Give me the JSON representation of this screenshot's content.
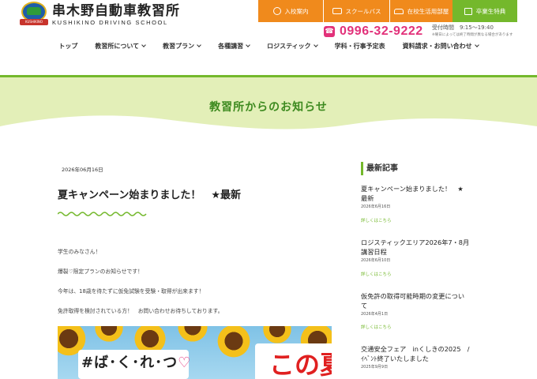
{
  "brand": {
    "name_jp": "串木野自動車教習所",
    "name_en": "KUSHIKINO DRIVING SCHOOL",
    "emblem_ribbon": "KUSHIKINO DRIVING"
  },
  "top_nav": [
    {
      "label": "入校案内",
      "icon": "steering-wheel-icon"
    },
    {
      "label": "スクールバス",
      "icon": "bus-icon"
    },
    {
      "label": "在校生活用部屋",
      "icon": "car-icon"
    },
    {
      "label": "卒業生特典",
      "icon": "gift-icon"
    }
  ],
  "contact": {
    "phone_icon_glyph": "☎",
    "phone": "0996-32-9222",
    "hours_label": "受付時間",
    "hours_value": "9:15～19:40",
    "hours_note": "※曜日によっては終了時間が異なる場合があります"
  },
  "main_nav": [
    {
      "label": "トップ",
      "has_dropdown": false
    },
    {
      "label": "教習所について",
      "has_dropdown": true
    },
    {
      "label": "教習プラン",
      "has_dropdown": true
    },
    {
      "label": "各種講習",
      "has_dropdown": true
    },
    {
      "label": "ロジスティック",
      "has_dropdown": true
    },
    {
      "label": "学科・行事予定表",
      "has_dropdown": false
    },
    {
      "label": "資料請求・お問い合わせ",
      "has_dropdown": true
    }
  ],
  "hero": {
    "title": "教習所からのお知らせ"
  },
  "article": {
    "date": "2026年06月16日",
    "title": "夏キャンペーン始まりました！　★最新",
    "paragraphs": [
      "学生のみなさん！",
      "爆裂♡限定プランのお知らせです！",
      "今年は、18歳を待たずに仮免試験を受験・取得が出来ます！",
      "免許取得を検討されている方！　お問い合わせお待ちしております。"
    ],
    "image": {
      "hashtag": "#ば･く･れ･つ",
      "heart": "♡",
      "headline": "この夏、"
    }
  },
  "sidebar": {
    "heading": "最新記事",
    "more_label": "詳しくはこちら",
    "posts": [
      {
        "title_lines": [
          "夏キャンペーン始まりました！　★",
          "最新"
        ],
        "date": "2026年6月16日"
      },
      {
        "title_lines": [
          "ロジスティックエリア2026年7・8月",
          "講習日程"
        ],
        "date": "2026年6月10日"
      },
      {
        "title_lines": [
          "仮免許の取得可能時期の変更につい",
          "て"
        ],
        "date": "2026年4月1日"
      },
      {
        "title_lines": [
          "交通安全フェア　inくしきの2025　/",
          "ｲﾍﾞﾝﾄ終了いたしました"
        ],
        "date": "2025年9月9日"
      }
    ]
  },
  "colors": {
    "accent_green": "#74b82c",
    "title_green": "#3d8a1f",
    "orange": "#f08a1c",
    "pink": "#e2317a",
    "hero_bg": "#e3efb8"
  }
}
